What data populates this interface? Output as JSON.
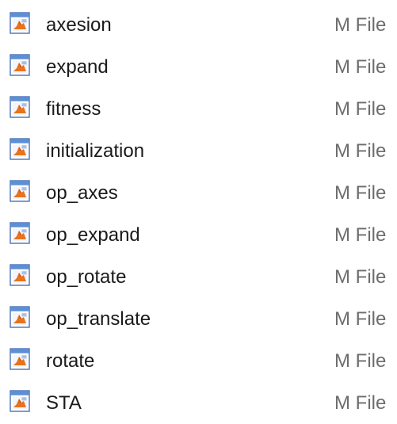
{
  "files": [
    {
      "name": "axesion",
      "type": "M File",
      "icon": "matlab-m-file-icon"
    },
    {
      "name": "expand",
      "type": "M File",
      "icon": "matlab-m-file-icon"
    },
    {
      "name": "fitness",
      "type": "M File",
      "icon": "matlab-m-file-icon"
    },
    {
      "name": "initialization",
      "type": "M File",
      "icon": "matlab-m-file-icon"
    },
    {
      "name": "op_axes",
      "type": "M File",
      "icon": "matlab-m-file-icon"
    },
    {
      "name": "op_expand",
      "type": "M File",
      "icon": "matlab-m-file-icon"
    },
    {
      "name": "op_rotate",
      "type": "M File",
      "icon": "matlab-m-file-icon"
    },
    {
      "name": "op_translate",
      "type": "M File",
      "icon": "matlab-m-file-icon"
    },
    {
      "name": "rotate",
      "type": "M File",
      "icon": "matlab-m-file-icon"
    },
    {
      "name": "STA",
      "type": "M File",
      "icon": "matlab-m-file-icon"
    }
  ],
  "colors": {
    "name_text": "#1a1a1a",
    "type_text": "#6d6d6d",
    "icon_frame": "#4a72b8",
    "icon_header": "#5b8fd6",
    "icon_accent": "#e8731c"
  }
}
